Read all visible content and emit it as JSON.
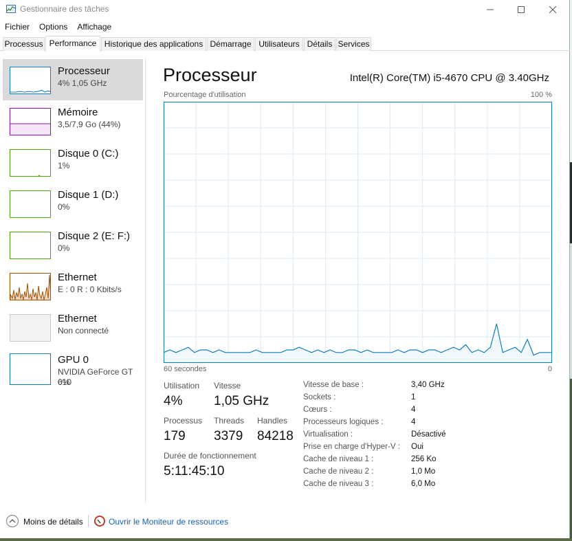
{
  "window": {
    "title": "Gestionnaire des tâches",
    "controls": {
      "minimize": "—",
      "maximize": "☐",
      "close": "✕"
    }
  },
  "menu": [
    "Fichier",
    "Options",
    "Affichage"
  ],
  "tabs": [
    {
      "label": "Processus",
      "active": false
    },
    {
      "label": "Performance",
      "active": true
    },
    {
      "label": "Historique des applications",
      "active": false
    },
    {
      "label": "Démarrage",
      "active": false
    },
    {
      "label": "Utilisateurs",
      "active": false
    },
    {
      "label": "Détails",
      "active": false
    },
    {
      "label": "Services",
      "active": false
    }
  ],
  "sidebar": [
    {
      "title": "Processeur",
      "sub": "4% 1,05 GHz",
      "sub2": "",
      "color": "#117dbb",
      "selected": true
    },
    {
      "title": "Mémoire",
      "sub": "3,5/7,9 Go (44%)",
      "sub2": "",
      "color": "#8b12ae",
      "selected": false
    },
    {
      "title": "Disque 0 (C:)",
      "sub": "1%",
      "sub2": "",
      "color": "#4da60c",
      "selected": false
    },
    {
      "title": "Disque 1 (D:)",
      "sub": "0%",
      "sub2": "",
      "color": "#4da60c",
      "selected": false
    },
    {
      "title": "Disque 2 (E: F:)",
      "sub": "0%",
      "sub2": "",
      "color": "#4da60c",
      "selected": false
    },
    {
      "title": "Ethernet",
      "sub": "E : 0 R : 0 Kbits/s",
      "sub2": "",
      "color": "#a74f01",
      "selected": false
    },
    {
      "title": "Ethernet",
      "sub": "Non connecté",
      "sub2": "",
      "color": "#c8c8c8",
      "selected": false
    },
    {
      "title": "GPU 0",
      "sub": "NVIDIA GeForce GT 610",
      "sub2": "0%",
      "color": "#117dbb",
      "selected": false
    }
  ],
  "main": {
    "title": "Processeur",
    "cpu_name": "Intel(R) Core(TM) i5-4670 CPU @ 3.40GHz",
    "graph_label": "Pourcentage d'utilisation",
    "graph_max": "100 %",
    "graph_x_left": "60 secondes",
    "graph_x_right": "0",
    "accent": "#117dbb",
    "usage_history": [
      4,
      5,
      4,
      5,
      6,
      4,
      5,
      5,
      4,
      5,
      4,
      4,
      4,
      4,
      4,
      5,
      4,
      4,
      4,
      4,
      5,
      5,
      6,
      5,
      4,
      5,
      4,
      5,
      4,
      4,
      5,
      5,
      4,
      5,
      4,
      4,
      4,
      4,
      5,
      4,
      5,
      5,
      4,
      5,
      5,
      4,
      5,
      6,
      5,
      7,
      4,
      5,
      4,
      6,
      15,
      4,
      5,
      6,
      4,
      9,
      3,
      4,
      4,
      4
    ]
  },
  "stats": {
    "utilisation": {
      "label": "Utilisation",
      "value": "4%"
    },
    "vitesse": {
      "label": "Vitesse",
      "value": "1,05 GHz"
    },
    "processus": {
      "label": "Processus",
      "value": "179"
    },
    "threads": {
      "label": "Threads",
      "value": "3379"
    },
    "handles": {
      "label": "Handles",
      "value": "84218"
    },
    "uptime": {
      "label": "Durée de fonctionnement",
      "value": "5:11:45:10"
    }
  },
  "info": [
    {
      "key": "Vitesse de base :",
      "value": "3,40 GHz"
    },
    {
      "key": "Sockets :",
      "value": "1"
    },
    {
      "key": "Cœurs :",
      "value": "4"
    },
    {
      "key": "Processeurs logiques :",
      "value": "4"
    },
    {
      "key": "Virtualisation :",
      "value": "Désactivé"
    },
    {
      "key": "Prise en charge d'Hyper-V :",
      "value": "Oui"
    },
    {
      "key": "Cache de niveau 1 :",
      "value": "256 Ko"
    },
    {
      "key": "Cache de niveau 2 :",
      "value": "1,0 Mo"
    },
    {
      "key": "Cache de niveau 3 :",
      "value": "6,0 Mo"
    }
  ],
  "footer": {
    "less_details": "Moins de détails",
    "monitor_link": "Ouvrir le Moniteur de ressources"
  }
}
